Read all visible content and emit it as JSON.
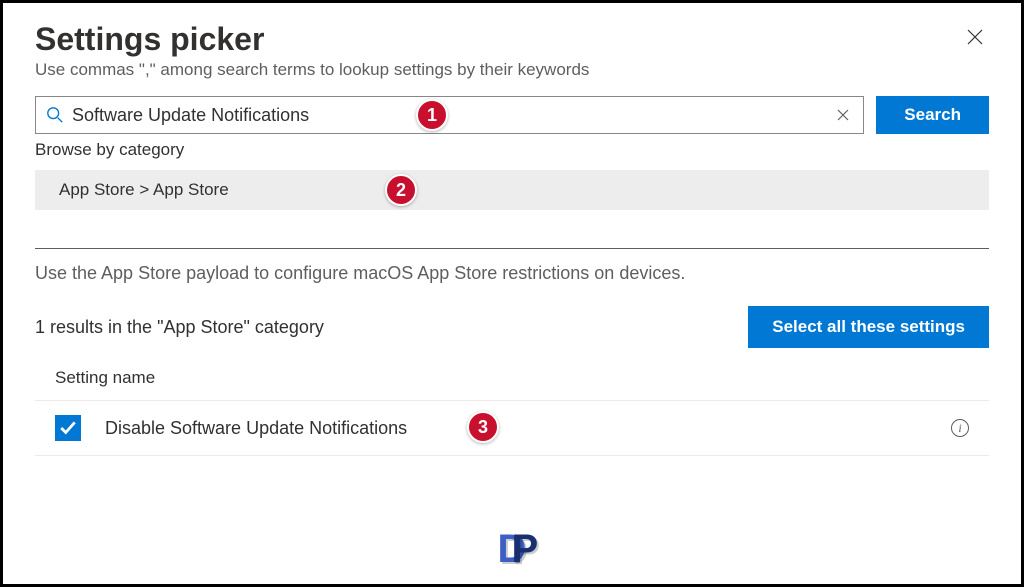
{
  "header": {
    "title": "Settings picker",
    "subtitle": "Use commas \",\" among search terms to lookup settings by their keywords"
  },
  "search": {
    "value": "Software Update Notifications",
    "button_label": "Search"
  },
  "browse": {
    "label": "Browse by category",
    "breadcrumb": "App Store  >  App Store"
  },
  "payload_description": "Use the App Store payload to configure macOS App Store restrictions on devices.",
  "results": {
    "count_text": "1 results in the \"App Store\" category",
    "select_all_label": "Select all these settings",
    "column_header": "Setting name"
  },
  "settings": [
    {
      "label": "Disable Software Update Notifications",
      "checked": true
    }
  ],
  "markers": {
    "m1": "1",
    "m2": "2",
    "m3": "3"
  }
}
